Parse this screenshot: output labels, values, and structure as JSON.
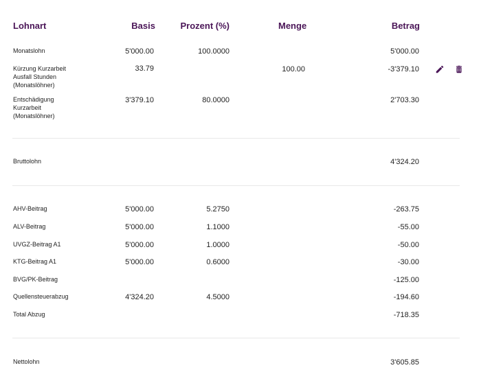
{
  "headers": {
    "lohnart": "Lohnart",
    "basis": "Basis",
    "prozent": "Prozent (%)",
    "menge": "Menge",
    "betrag": "Betrag"
  },
  "rows": {
    "monatslohn": {
      "label": "Monatslohn",
      "basis": "5'000.00",
      "prozent": "100.0000",
      "betrag": "5'000.00"
    },
    "kurzarbeit_ausfall": {
      "label_line1": "Kürzung Kurzarbeit",
      "label_line2": "Ausfall Stunden",
      "label_line3": "(Monatslöhner)",
      "basis": "33.79",
      "menge": "100.00",
      "betrag": "-3'379.10"
    },
    "entschaedigung": {
      "label_line1": "Entschädigung",
      "label_line2": "Kurzarbeit",
      "label_line3": "(Monatslöhner)",
      "basis": "3'379.10",
      "prozent": "80.0000",
      "betrag": "2'703.30"
    },
    "bruttolohn": {
      "label": "Bruttolohn",
      "betrag": "4'324.20"
    },
    "ahv": {
      "label": "AHV-Beitrag",
      "basis": "5'000.00",
      "prozent": "5.2750",
      "betrag": "-263.75"
    },
    "alv": {
      "label": "ALV-Beitrag",
      "basis": "5'000.00",
      "prozent": "1.1000",
      "betrag": "-55.00"
    },
    "uvgz": {
      "label": "UVGZ-Beitrag A1",
      "basis": "5'000.00",
      "prozent": "1.0000",
      "betrag": "-50.00"
    },
    "ktg": {
      "label": "KTG-Beitrag A1",
      "basis": "5'000.00",
      "prozent": "0.6000",
      "betrag": "-30.00"
    },
    "bvg": {
      "label": "BVG/PK-Beitrag",
      "betrag": "-125.00"
    },
    "quellensteuer": {
      "label": "Quellensteuerabzug",
      "basis": "4'324.20",
      "prozent": "4.5000",
      "betrag": "-194.60"
    },
    "total_abzug": {
      "label": "Total Abzug",
      "betrag": "-718.35"
    },
    "nettolohn": {
      "label": "Nettolohn",
      "betrag": "3'605.85"
    }
  },
  "icons": {
    "edit": "pencil-icon",
    "delete": "trash-icon"
  },
  "colors": {
    "header": "#4a1557",
    "icon": "#4a1557",
    "divider": "#e8e8e8"
  }
}
